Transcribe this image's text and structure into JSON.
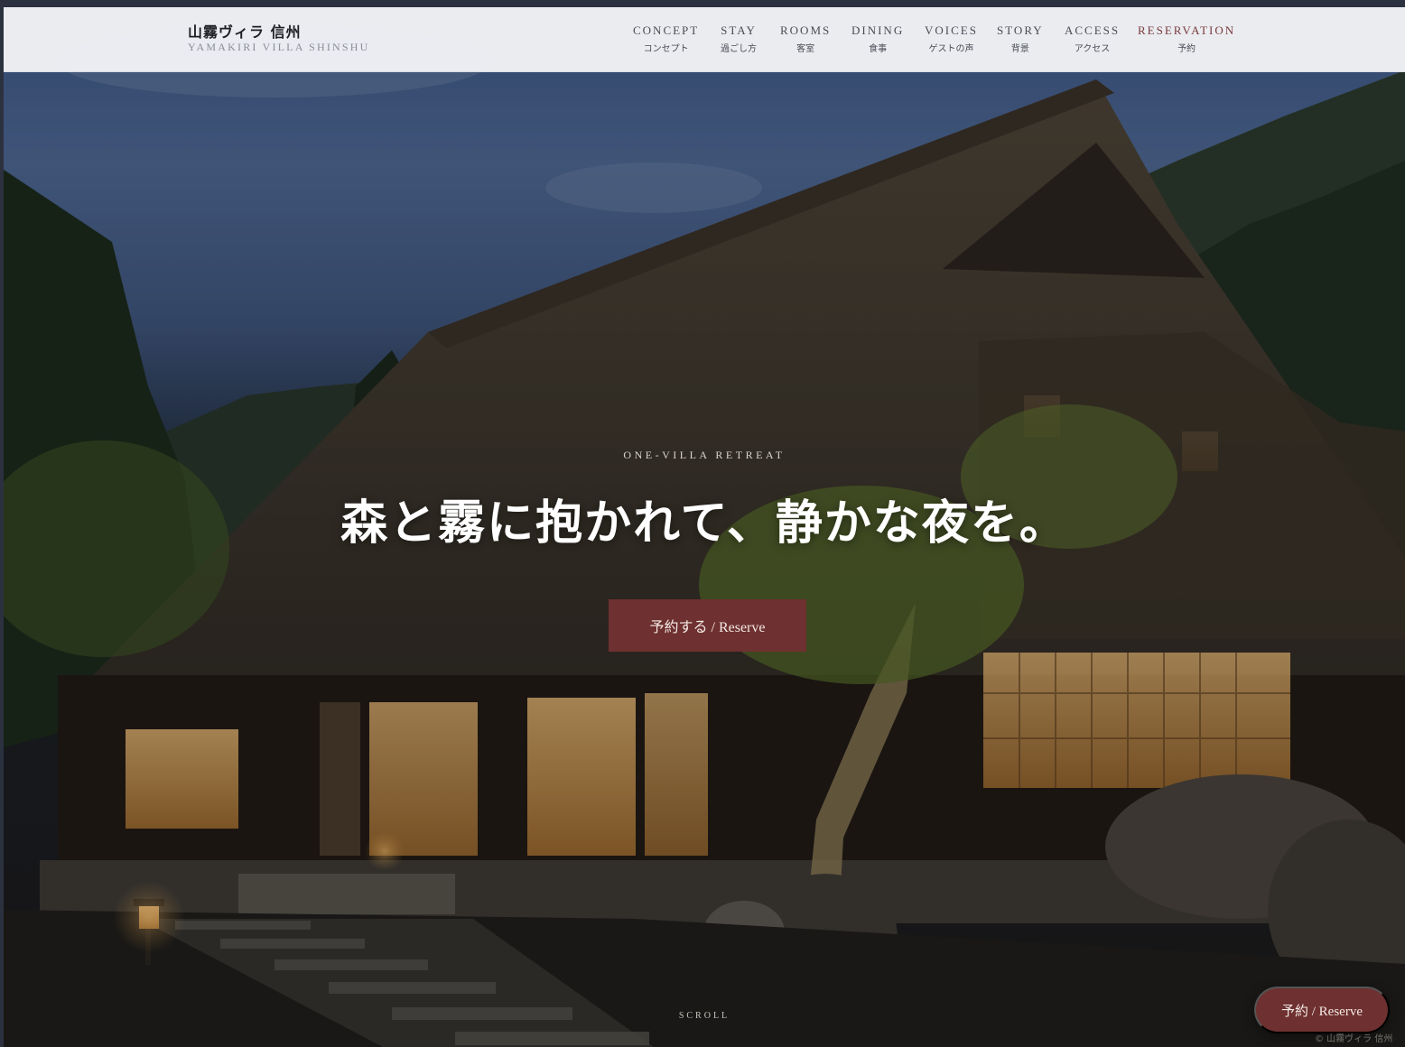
{
  "brand": {
    "name_ja": "山霧ヴィラ 信州",
    "name_en": "YAMAKIRI VILLA SHINSHU"
  },
  "nav": {
    "items": [
      {
        "en": "CONCEPT",
        "ja": "コンセプト"
      },
      {
        "en": "STAY",
        "ja": "過ごし方"
      },
      {
        "en": "ROOMS",
        "ja": "客室"
      },
      {
        "en": "DINING",
        "ja": "食事"
      },
      {
        "en": "VOICES",
        "ja": "ゲストの声"
      },
      {
        "en": "STORY",
        "ja": "背景"
      },
      {
        "en": "ACCESS",
        "ja": "アクセス"
      },
      {
        "en": "RESERVATION",
        "ja": "予約"
      }
    ]
  },
  "hero": {
    "eyebrow": "ONE-VILLA RETREAT",
    "headline": "森と霧に抱かれて、静かな夜を。",
    "cta_label": "予約する / Reserve",
    "scroll_label": "SCROLL",
    "image_description_icon": "thatched-villa-night-photo"
  },
  "floating": {
    "reserve_label": "予約 / Reserve"
  },
  "footer": {
    "copyright": "© 山霧ヴィラ 信州"
  },
  "colors": {
    "accent": "#6e3030",
    "header_bg": "#f1f3f6",
    "nav_text": "#4a4d55",
    "nav_accent": "#7a3a3c"
  }
}
